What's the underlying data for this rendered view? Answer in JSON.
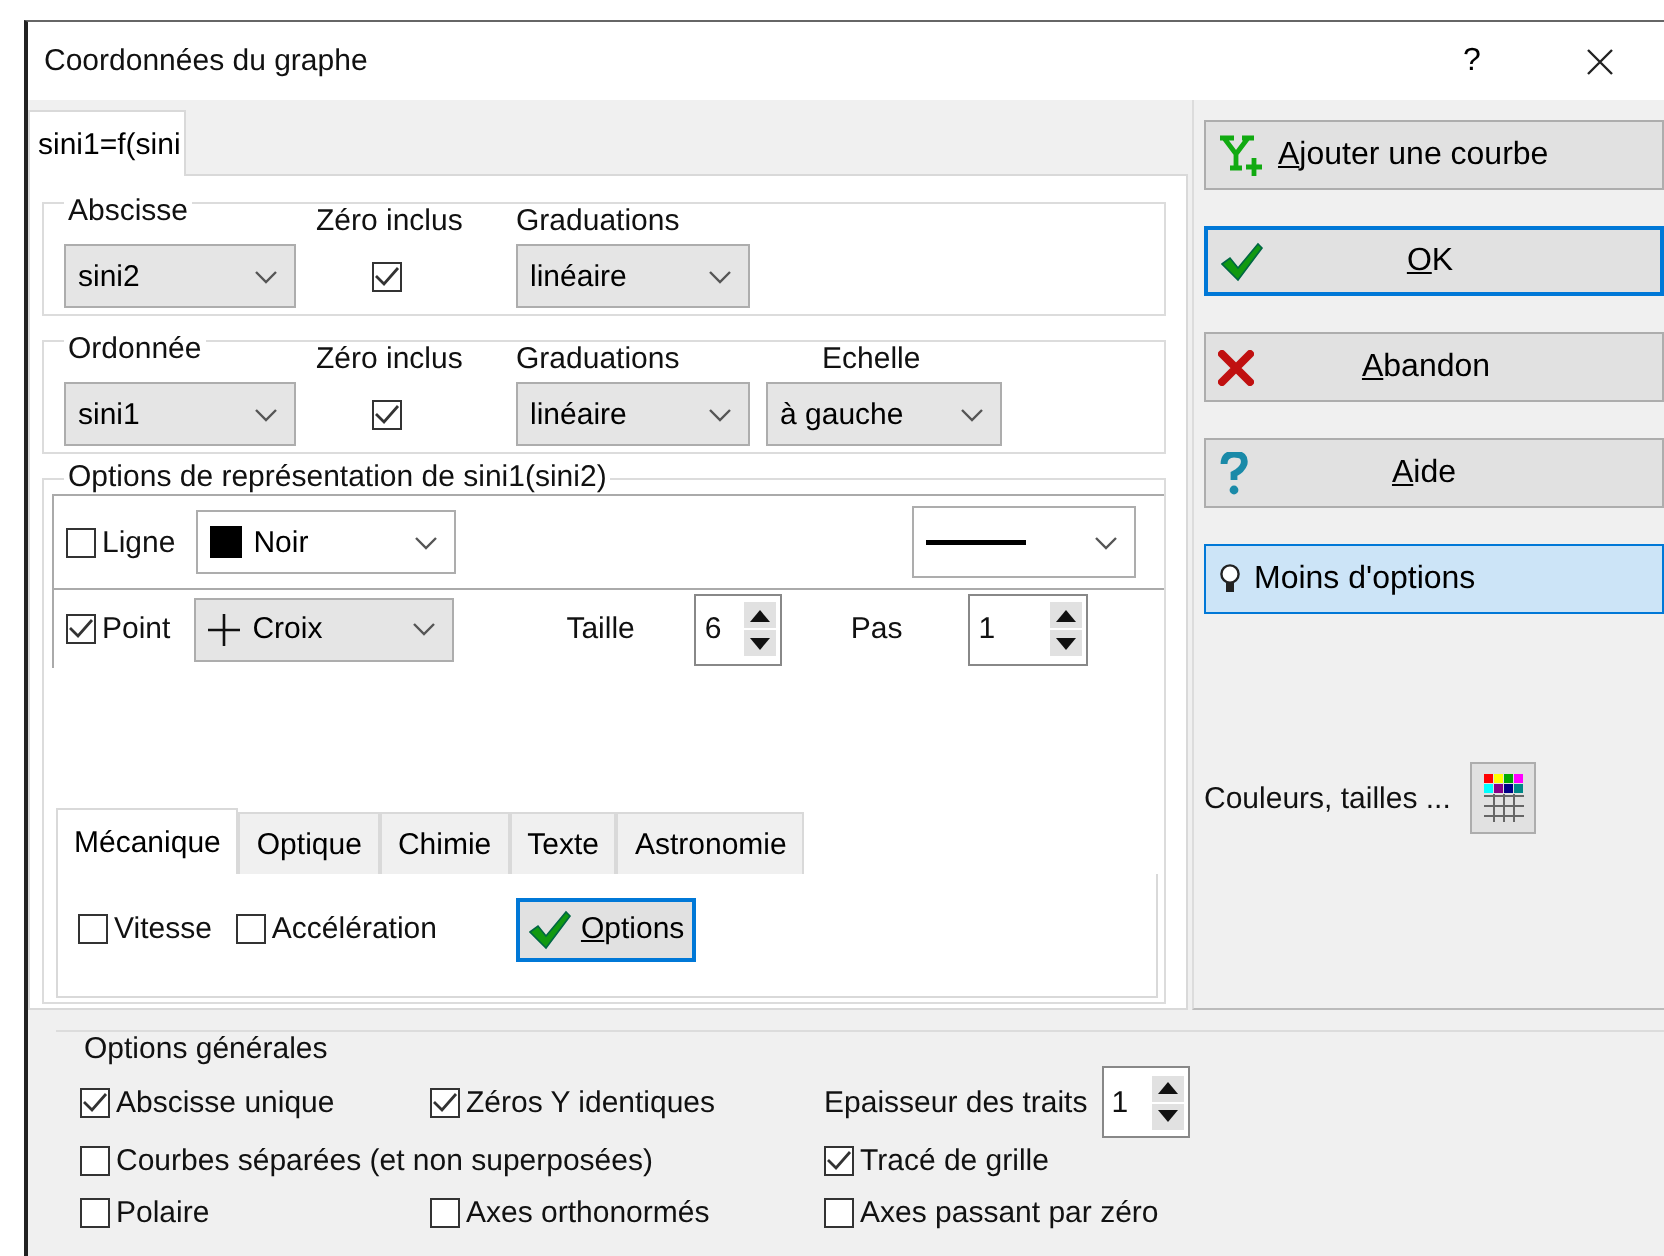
{
  "window": {
    "title": "Coordonnées du graphe",
    "help_button": "?"
  },
  "curve_tabs": [
    {
      "label": "sini1=f(sini",
      "selected": true
    }
  ],
  "abscissa": {
    "legend": "Abscisse",
    "zero_label": "Zéro inclus",
    "graduation_label": "Graduations",
    "variable": "sini2",
    "zero_included": true,
    "graduation": "linéaire"
  },
  "ordinate": {
    "legend": "Ordonnée",
    "zero_label": "Zéro inclus",
    "graduation_label": "Graduations",
    "scale_label": "Echelle",
    "variable": "sini1",
    "zero_included": true,
    "graduation": "linéaire",
    "scale": "à gauche"
  },
  "representation": {
    "legend": "Options de représentation de sini1(sini2)",
    "line": {
      "label": "Ligne",
      "checked": false,
      "color_name": "Noir"
    },
    "point": {
      "label": "Point",
      "checked": true,
      "symbol": "Croix",
      "size_label": "Taille",
      "size": "6",
      "step_label": "Pas",
      "step": "1"
    },
    "tabs": [
      {
        "label": "Mécanique",
        "selected": true
      },
      {
        "label": "Optique",
        "selected": false
      },
      {
        "label": "Chimie",
        "selected": false
      },
      {
        "label": "Texte",
        "selected": false
      },
      {
        "label": "Astronomie",
        "selected": false
      }
    ],
    "tab_options": [
      {
        "label": "Vitesse",
        "checked": false
      },
      {
        "label": "Accélération",
        "checked": false
      }
    ],
    "options_button": {
      "label": "Options",
      "underline_first": true
    }
  },
  "buttons": [
    {
      "kind": "add",
      "label": "Ajouter une courbe",
      "underline_first": true,
      "focused": false,
      "highlighted": false
    },
    {
      "kind": "ok",
      "label": "OK",
      "underline_first": true,
      "focused": true,
      "highlighted": false
    },
    {
      "kind": "cancel",
      "label": "Abandon",
      "underline_first": true,
      "focused": false,
      "highlighted": false
    },
    {
      "kind": "help",
      "label": "Aide",
      "underline_first": true,
      "focused": false,
      "highlighted": false
    },
    {
      "kind": "less",
      "label": "Moins d'options",
      "underline_first": false,
      "focused": false,
      "highlighted": true
    }
  ],
  "colors_label": "Couleurs, tailles ...",
  "general": {
    "legend": "Options générales",
    "rows": [
      [
        {
          "kind": "check",
          "label": "Abscisse unique",
          "checked": true
        },
        {
          "kind": "check",
          "label": "Zéros Y identiques",
          "checked": true
        },
        {
          "kind": "spin",
          "label": "Epaisseur des traits",
          "value": "1"
        }
      ],
      [
        {
          "kind": "check",
          "label": "Courbes séparées (et non superposées)",
          "checked": false
        },
        {
          "kind": "blank"
        },
        {
          "kind": "check",
          "label": "Tracé de grille",
          "checked": true
        }
      ],
      [
        {
          "kind": "check",
          "label": "Polaire",
          "checked": false
        },
        {
          "kind": "check",
          "label": "Axes orthonormés",
          "checked": false
        },
        {
          "kind": "check",
          "label": "Axes passant par zéro",
          "checked": false
        }
      ]
    ]
  }
}
